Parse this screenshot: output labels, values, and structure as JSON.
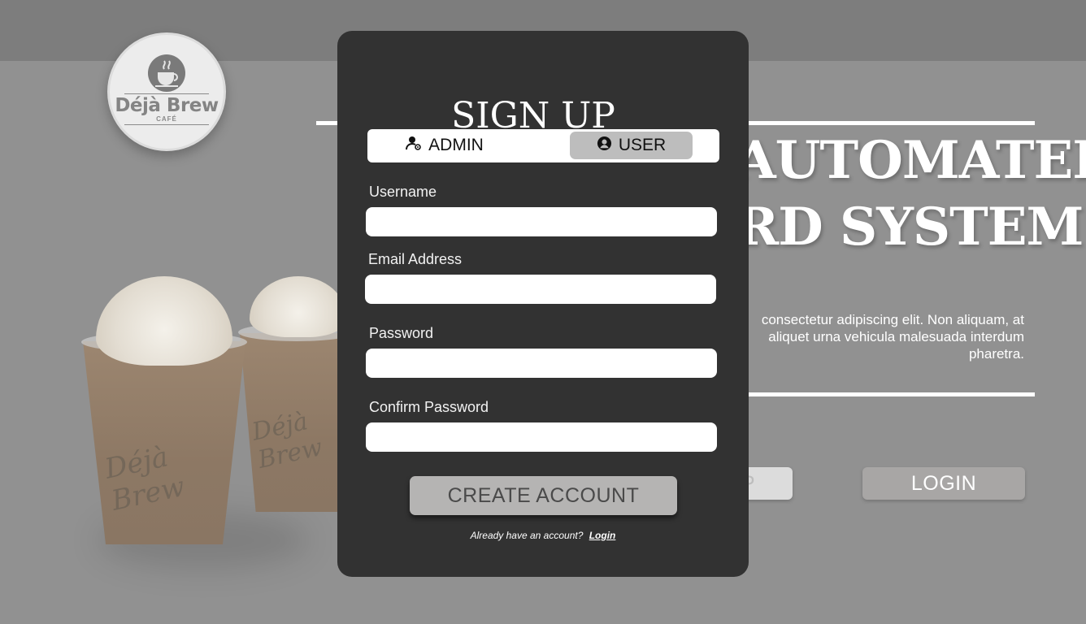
{
  "background": {
    "logo": {
      "name": "Déjà Brew",
      "subtitle": "CAFÉ"
    },
    "hero": {
      "title_line1": "AUTOMATED",
      "title_line2": "RD SYSTEM",
      "description": "consectetur adipiscing elit. Non aliquam, at aliquet urna vehicula malesuada interdum pharetra."
    },
    "buttons": {
      "partial_label": "P",
      "login_label": "LOGIN"
    },
    "cup_script": "Déjà Brew"
  },
  "modal": {
    "title": "SIGN UP",
    "roles": [
      {
        "label": "ADMIN",
        "icon": "admin-user-icon",
        "selected": false
      },
      {
        "label": "USER",
        "icon": "user-circle-icon",
        "selected": true
      }
    ],
    "fields": [
      {
        "label": "Username",
        "value": "",
        "placeholder": ""
      },
      {
        "label": "Email Address",
        "value": "",
        "placeholder": ""
      },
      {
        "label": "Password",
        "value": "",
        "placeholder": ""
      },
      {
        "label": "Confirm Password",
        "value": "",
        "placeholder": ""
      }
    ],
    "create_label": "CREATE ACCOUNT",
    "already_text": "Already have an account?",
    "login_link": "Login"
  },
  "colors": {
    "overlay_bg": "#919191",
    "modal_bg": "#323232",
    "selected_role_bg": "#bdbdbd",
    "create_button_bg": "#b5b4b3",
    "login_button_bg": "#a8a6a5"
  }
}
